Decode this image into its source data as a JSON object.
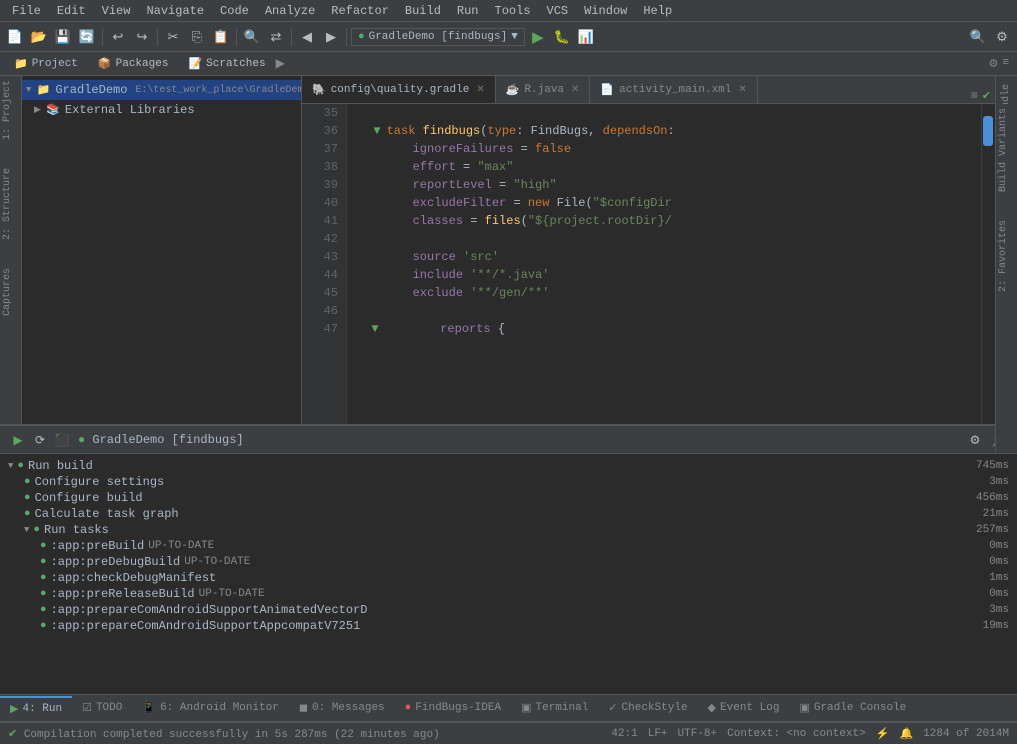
{
  "menubar": {
    "items": [
      "File",
      "Edit",
      "View",
      "Navigate",
      "Code",
      "Analyze",
      "Refactor",
      "Build",
      "Run",
      "Tools",
      "VCS",
      "Window",
      "Help"
    ]
  },
  "breadcrumb": {
    "items": [
      "GradleDemo",
      "config",
      "quality.gradle"
    ]
  },
  "project_tabs": {
    "tabs": [
      "Project",
      "Packages",
      "Scratches"
    ],
    "more": "▶"
  },
  "editor_tabs": [
    {
      "id": "quality_gradle",
      "label": "config\\quality.gradle",
      "icon": "gradle",
      "active": true
    },
    {
      "id": "r_java",
      "label": "R.java",
      "icon": "java",
      "active": false
    },
    {
      "id": "activity_main_xml",
      "label": "activity_main.xml",
      "icon": "xml",
      "active": false
    }
  ],
  "code": {
    "lines": [
      {
        "num": 35,
        "content": ""
      },
      {
        "num": 36,
        "content": "    task findbugs(type: FindBugs, dependsOn:"
      },
      {
        "num": 37,
        "content": "        ignoreFailures = false"
      },
      {
        "num": 38,
        "content": "        effort = \"max\""
      },
      {
        "num": 39,
        "content": "        reportLevel = \"high\""
      },
      {
        "num": 40,
        "content": "        excludeFilter = new File(\"$configDir"
      },
      {
        "num": 41,
        "content": "        classes = files(\"${project.rootDir}/"
      },
      {
        "num": 42,
        "content": ""
      },
      {
        "num": 43,
        "content": "        source 'src'"
      },
      {
        "num": 44,
        "content": "        include '**/*.java'"
      },
      {
        "num": 45,
        "content": "        exclude '**/gen/**'"
      },
      {
        "num": 46,
        "content": ""
      },
      {
        "num": 47,
        "content": "        reports {"
      }
    ]
  },
  "project_tree": {
    "items": [
      {
        "id": "gradle_demo",
        "label": "GradleDemo",
        "path": "E:\\test_work_place\\GradleDemo",
        "level": 0,
        "expanded": true,
        "selected": true
      },
      {
        "id": "external_libs",
        "label": "External Libraries",
        "level": 0,
        "expanded": false
      }
    ]
  },
  "run_panel": {
    "title": "GradleDemo [findbugs]",
    "tab_label": "4: Run",
    "items": [
      {
        "id": "run_build",
        "label": "Run build",
        "time": "745ms",
        "level": 0,
        "expanded": true,
        "has_children": true
      },
      {
        "id": "configure_settings",
        "label": "Configure settings",
        "time": "3ms",
        "level": 1
      },
      {
        "id": "configure_build",
        "label": "Configure build",
        "time": "456ms",
        "level": 1
      },
      {
        "id": "calculate_task",
        "label": "Calculate task graph",
        "time": "21ms",
        "level": 1
      },
      {
        "id": "run_tasks",
        "label": "Run tasks",
        "time": "257ms",
        "level": 1,
        "expanded": true,
        "has_children": true
      },
      {
        "id": "app_prebuild",
        "label": ":app:preBuild",
        "suffix": "UP-TO-DATE",
        "time": "0ms",
        "level": 2
      },
      {
        "id": "app_predebugbuild",
        "label": ":app:preDebugBuild",
        "suffix": "UP-TO-DATE",
        "time": "0ms",
        "level": 2
      },
      {
        "id": "app_checkdebug",
        "label": ":app:checkDebugManifest",
        "time": "1ms",
        "level": 2
      },
      {
        "id": "app_prerelease",
        "label": ":app:preReleaseBuild",
        "suffix": "UP-TO-DATE",
        "time": "0ms",
        "level": 2
      },
      {
        "id": "app_prepare_animated",
        "label": ":app:prepareComAndroidSupportAnimatedVectorD",
        "time": "3ms",
        "level": 2
      },
      {
        "id": "app_prepare_compat",
        "label": ":app:prepareComAndroidSupportAppcompatV7251",
        "time": "19ms",
        "level": 2
      }
    ]
  },
  "bottom_tabs": [
    {
      "label": "4: Run",
      "icon": "▶",
      "icon_color": "#58a85d",
      "active": true
    },
    {
      "label": "TODO",
      "icon": "☑",
      "icon_color": "#a9b7c6",
      "active": false
    },
    {
      "label": "6: Android Monitor",
      "icon": "●",
      "icon_color": "#a9b7c6",
      "active": false
    },
    {
      "label": "0: Messages",
      "icon": "◼",
      "icon_color": "#a9b7c6",
      "active": false
    },
    {
      "label": "FindBugs-IDEA",
      "icon": "●",
      "icon_color": "#e05555",
      "active": false
    },
    {
      "label": "Terminal",
      "icon": "▣",
      "icon_color": "#a9b7c6",
      "active": false
    },
    {
      "label": "CheckStyle",
      "icon": "●",
      "icon_color": "#a9b7c6",
      "active": false
    },
    {
      "label": "Event Log",
      "icon": "◆",
      "icon_color": "#a9b7c6",
      "active": false
    },
    {
      "label": "Gradle Console",
      "icon": "▣",
      "icon_color": "#a9b7c6",
      "active": false
    }
  ],
  "status_bar": {
    "left": "Compilation completed successfully in 5s 287ms (22 minutes ago)",
    "position": "42:1",
    "line_sep": "LF+",
    "encoding": "UTF-8+",
    "context": "Context: <no context>",
    "memory": "1284 of 2014M"
  },
  "right_side_labels": [
    "Gradle"
  ],
  "left_side_labels": [
    "1: Project",
    "2: Structure",
    "Captures",
    "Build Variants",
    "2: Favorites"
  ]
}
